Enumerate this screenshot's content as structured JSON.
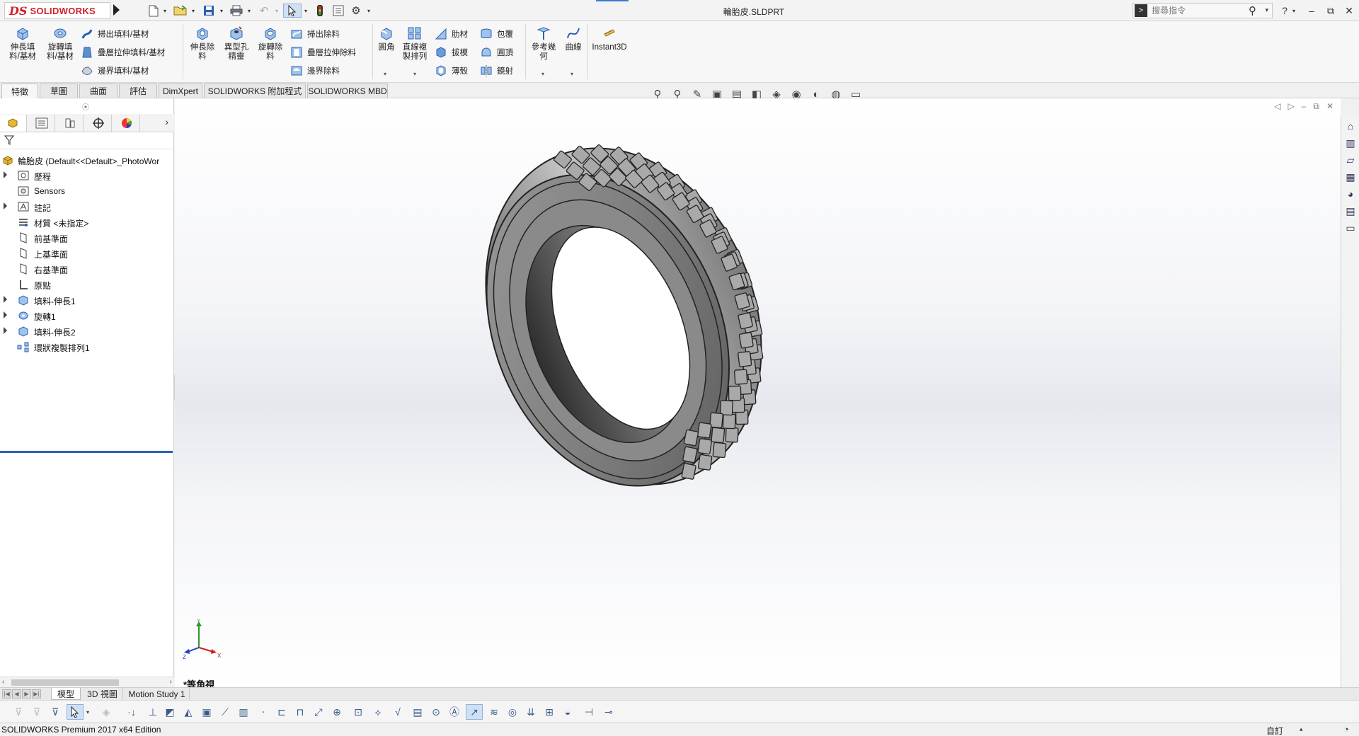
{
  "app": {
    "logo_mark": "DS",
    "logo_text": "SOLIDWORKS",
    "document_title": "輪胎皮.SLDPRT",
    "search_placeholder": "搜尋指令",
    "help_glyph": "?",
    "minimize_glyph": "–",
    "restore_glyph": "⧉",
    "close_glyph": "✕"
  },
  "quick_access": {
    "new_icon": "new-document-icon",
    "open_icon": "open-folder-icon",
    "save_icon": "save-icon",
    "print_icon": "print-icon",
    "undo_icon": "undo-icon",
    "select_icon": "select-pointer-icon",
    "rebuild_icon": "rebuild-traffic-light-icon",
    "file_props_icon": "file-properties-icon",
    "options_icon": "gear-icon"
  },
  "commands": {
    "extruded_boss": "伸長填\n料/基材",
    "revolved_boss": "旋轉填\n料/基材",
    "swept_boss": "掃出填料/基材",
    "lofted_boss": "疊層拉伸填料/基材",
    "boundary_boss": "邊界填料/基材",
    "extruded_cut": "伸長除\n料",
    "hole_wizard": "異型孔\n精靈",
    "revolved_cut": "旋轉除\n料",
    "swept_cut": "掃出除料",
    "lofted_cut": "疊層拉伸除料",
    "boundary_cut": "邊界除料",
    "fillet": "圓角",
    "linear_pattern": "直線複\n製排列",
    "rib": "肋材",
    "wrap": "包覆",
    "draft": "拔模",
    "dome": "圓頂",
    "shell": "薄殼",
    "mirror": "鏡射",
    "reference_geometry": "參考幾\n何",
    "curves": "曲線",
    "instant3d": "Instant3D"
  },
  "tabs": [
    "特徵",
    "草圖",
    "曲面",
    "評估",
    "DimXpert",
    "SOLIDWORKS 附加程式",
    "SOLIDWORKS MBD"
  ],
  "tree": {
    "root": "輪胎皮  (Default<<Default>_PhotoWor",
    "items": [
      {
        "label": "歷程",
        "icon": "history-folder-icon",
        "expandable": true
      },
      {
        "label": "Sensors",
        "icon": "sensors-icon",
        "expandable": false
      },
      {
        "label": "註記",
        "icon": "annotations-icon",
        "expandable": true
      },
      {
        "label": "材質 <未指定>",
        "icon": "material-icon",
        "expandable": false
      },
      {
        "label": "前基準面",
        "icon": "plane-icon",
        "expandable": false
      },
      {
        "label": "上基準面",
        "icon": "plane-icon",
        "expandable": false
      },
      {
        "label": "右基準面",
        "icon": "plane-icon",
        "expandable": false
      },
      {
        "label": "原點",
        "icon": "origin-icon",
        "expandable": false
      },
      {
        "label": "填料-伸長1",
        "icon": "extrude-feature-icon",
        "expandable": true
      },
      {
        "label": "旋轉1",
        "icon": "revolve-feature-icon",
        "expandable": true
      },
      {
        "label": "填料-伸長2",
        "icon": "extrude-feature-icon",
        "expandable": true
      },
      {
        "label": "環狀複製排列1",
        "icon": "circular-pattern-icon",
        "expandable": false
      }
    ]
  },
  "viewport": {
    "view_label": "*等角視",
    "triad_labels": {
      "x": "X",
      "y": "Y",
      "z": "Z"
    }
  },
  "bottom_tabs": [
    "模型",
    "3D 視圖",
    "Motion Study 1"
  ],
  "status": {
    "text": "SOLIDWORKS Premium 2017 x64 Edition",
    "unit_label": "自訂"
  },
  "colors": {
    "brand_red": "#d12027",
    "selection_blue": "#cfe0f5",
    "rollback_bar": "#2b5fb0",
    "tire_gray": "#8e8e8e"
  }
}
